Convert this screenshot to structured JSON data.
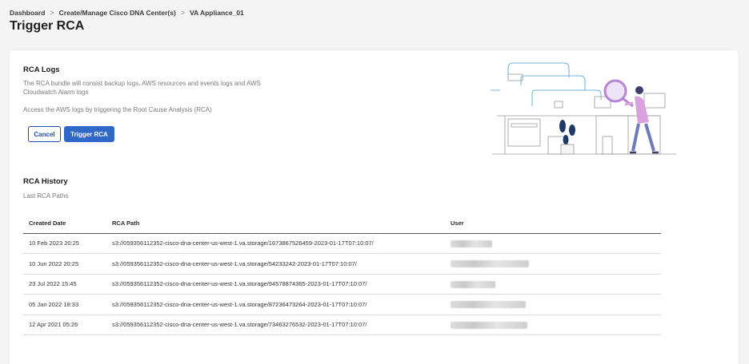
{
  "breadcrumb": {
    "items": [
      "Dashboard",
      "Create/Manage Cisco DNA Center(s)",
      "VA Appliance_01"
    ],
    "separator": ">"
  },
  "page_title": "Trigger RCA",
  "rca_logs": {
    "title": "RCA Logs",
    "description_line1": "The RCA bundle will consist backup logs, AWS resources and events logs and AWS",
    "description_line2": "Cloudwatch Alarm logs",
    "access_text": "Access the AWS logs by triggering the Root Cause Analysis (RCA)",
    "cancel_label": "Cancel",
    "trigger_label": "Trigger RCA"
  },
  "rca_history": {
    "title": "RCA History",
    "subtitle": "Last RCA Paths",
    "columns": [
      "Created Date",
      "RCA Path",
      "User"
    ],
    "rows": [
      {
        "date": "10 Feb 2023 20:25",
        "path": "s3://059356112352-cisco-dna-center-us-west-1.va.storage/1673867526459-2023-01-17T07:10:07/"
      },
      {
        "date": "10 Jun 2022 20:25",
        "path": "s3://059356112352-cisco-dna-center-us-west-1.va.storage/54233242-2023-01-17T07:10:07/"
      },
      {
        "date": "23 Jul 2022 15:45",
        "path": "s3://059356112352-cisco-dna-center-us-west-1.va.storage/94578874365-2023-01-17T07:10:07/"
      },
      {
        "date": "05 Jan 2022 18:33",
        "path": "s3://059356112352-cisco-dna-center-us-west-1.va.storage/87236473264-2023-01-17T07:10:07/"
      },
      {
        "date": "12 Apr 2021 05:26",
        "path": "s3://059356112352-cisco-dna-center-us-west-1.va.storage/73463276532-2023-01-17T07:10:07/"
      }
    ]
  },
  "colors": {
    "primary": "#2f68c9",
    "background": "#f4f4f5",
    "illustration_accent": "#b784d6"
  }
}
